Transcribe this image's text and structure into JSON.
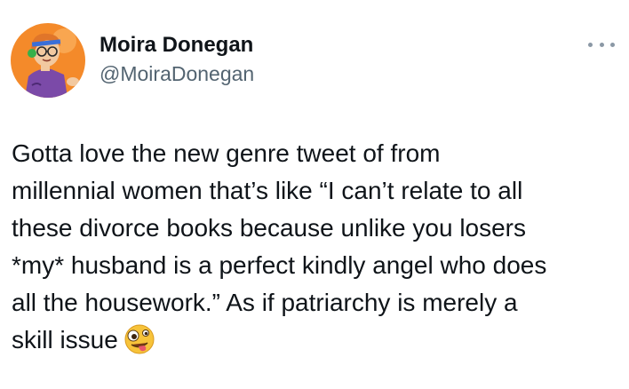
{
  "author": {
    "display_name": "Moira Donegan",
    "handle": "@MoiraDonegan"
  },
  "icons": {
    "avatar": "cartoon-character-avatar",
    "more": "more-options-icon",
    "emoji": "zany-face-emoji"
  },
  "colors": {
    "text": "#0f1419",
    "secondary": "#536471",
    "avatar_bg": "#f48a2a",
    "emoji": "#f7c33a"
  },
  "tweet": {
    "lines": [
      "Gotta love the new genre tweet of from",
      "millennial women that’s like “I can’t relate to all",
      "these divorce books because unlike you losers",
      "*my* husband is a perfect kindly angel who does",
      "all the housework.” As if patriarchy is merely a",
      "skill issue"
    ]
  }
}
